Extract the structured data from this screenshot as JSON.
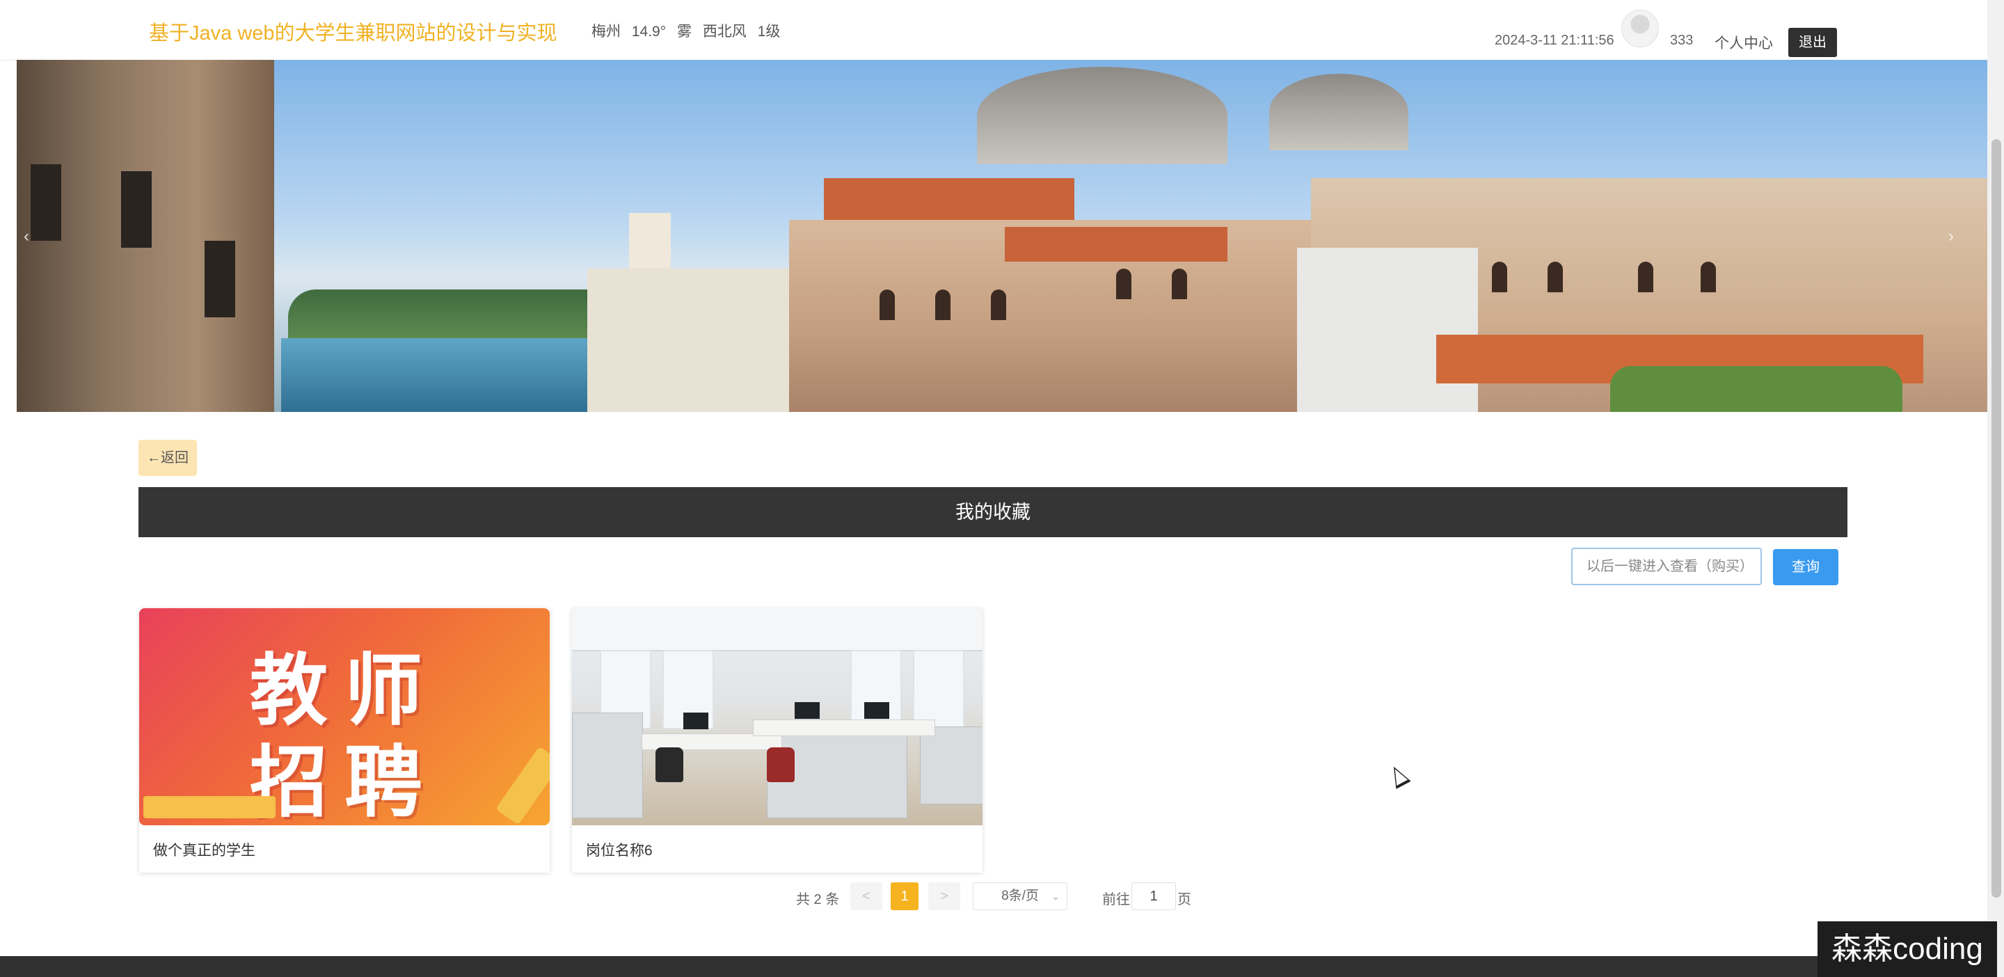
{
  "header": {
    "title": "基于Java web的大学生兼职网站的设计与实现",
    "weather": {
      "city": "梅州",
      "temperature": "14.9°",
      "condition": "雾",
      "wind": "西北风",
      "level": "1级"
    },
    "datetime": "2024-3-11 21:11:56",
    "username": "333",
    "center_label": "个人中心",
    "logout_label": "退出"
  },
  "banner": {
    "slides": 2,
    "active_index": 0
  },
  "page": {
    "back_label": "←返回",
    "section_title": "我的收藏",
    "search_placeholder": "以后一键进入查看（购买）",
    "search_button": "查询"
  },
  "cards": [
    {
      "caption": "做个真正的学生",
      "image": "teacher-recruitment-poster",
      "poster_line1": "教师",
      "poster_line2": "招聘"
    },
    {
      "caption": "岗位名称6",
      "image": "office-photo"
    }
  ],
  "pagination": {
    "total_text": "共 2 条",
    "prev": "<",
    "current": "1",
    "next": ">",
    "page_size": "8条/页",
    "goto_label": "前往",
    "goto_value": "1",
    "page_suffix": "页"
  },
  "watermark": "森森coding",
  "colors": {
    "title": "#f0b224",
    "back_button": "#fde5b3",
    "section_bar": "#353535",
    "search_button": "#3a9af0",
    "page_active": "#f5b320"
  }
}
